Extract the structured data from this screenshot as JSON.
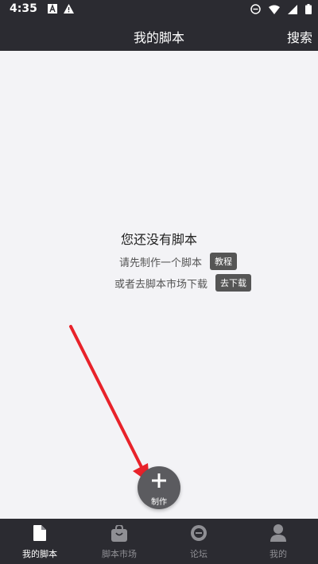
{
  "status": {
    "time": "4:35"
  },
  "header": {
    "title": "我的脚本",
    "search_label": "搜索"
  },
  "empty": {
    "title": "您还没有脚本",
    "line1": "请先制作一个脚本",
    "tutorial_button": "教程",
    "line2": "或者去脚本市场下载",
    "download_button": "去下载"
  },
  "fab": {
    "label": "制作"
  },
  "nav": {
    "items": [
      {
        "label": "我的脚本",
        "icon": "file-icon",
        "active": true
      },
      {
        "label": "脚本市场",
        "icon": "bag-icon",
        "active": false
      },
      {
        "label": "论坛",
        "icon": "chat-icon",
        "active": false
      },
      {
        "label": "我的",
        "icon": "person-icon",
        "active": false
      }
    ]
  },
  "colors": {
    "bar": "#2b2b31",
    "content": "#f3f3f6",
    "arrow": "#e8222a",
    "fab": "#5b5b5f"
  }
}
